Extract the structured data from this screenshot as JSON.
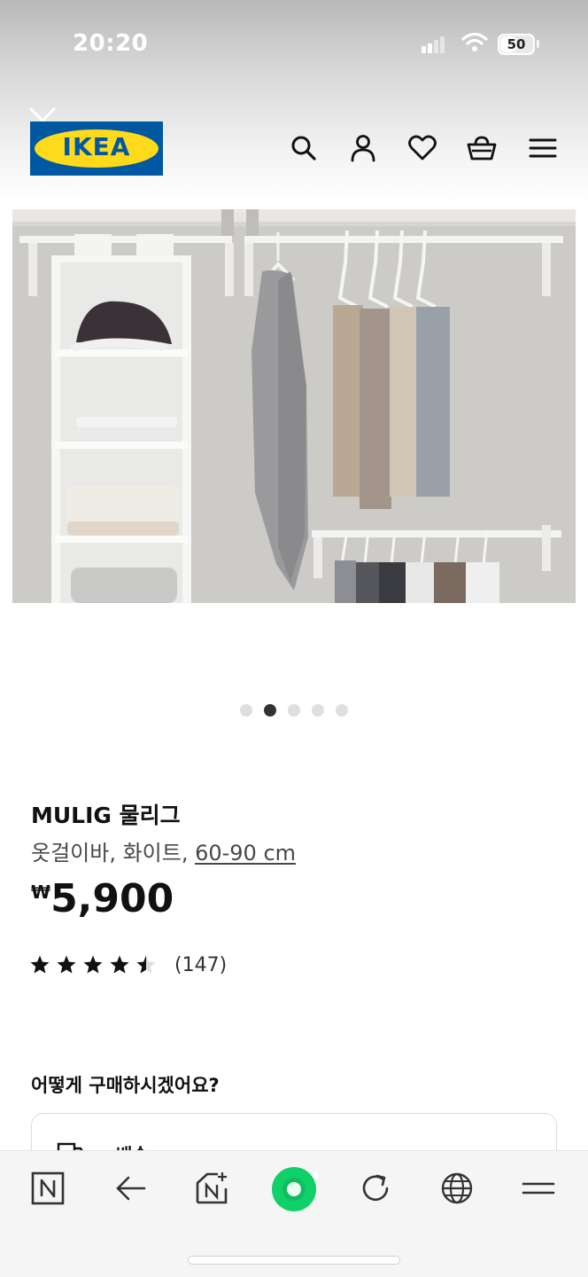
{
  "status_bar": {
    "time": "20:20",
    "battery": "50"
  },
  "header": {
    "logo_text": "IKEA",
    "icons": [
      "close-icon",
      "search-icon",
      "account-icon",
      "heart-icon",
      "basket-icon",
      "menu-icon"
    ]
  },
  "carousel": {
    "total": 5,
    "active_index": 1
  },
  "product": {
    "name": "MULIG 물리그",
    "description_prefix": "옷걸이바, 화이트, ",
    "size": "60-90 cm",
    "currency": "₩",
    "price": "5,900",
    "rating": 4.5,
    "review_count": "(147)"
  },
  "purchase": {
    "heading": "어떻게 구매하시겠어요?",
    "delivery_label": "배송"
  },
  "browser_bar": {
    "icons": [
      "naver-n-icon",
      "back-arrow-icon",
      "naver-new-tab-icon",
      "green-dot-home-icon",
      "refresh-icon",
      "globe-icon",
      "hamburger-menu-icon"
    ]
  },
  "colors": {
    "ikea_blue": "#0058a3",
    "ikea_yellow": "#ffda1a",
    "green_home": "#10d06a"
  }
}
